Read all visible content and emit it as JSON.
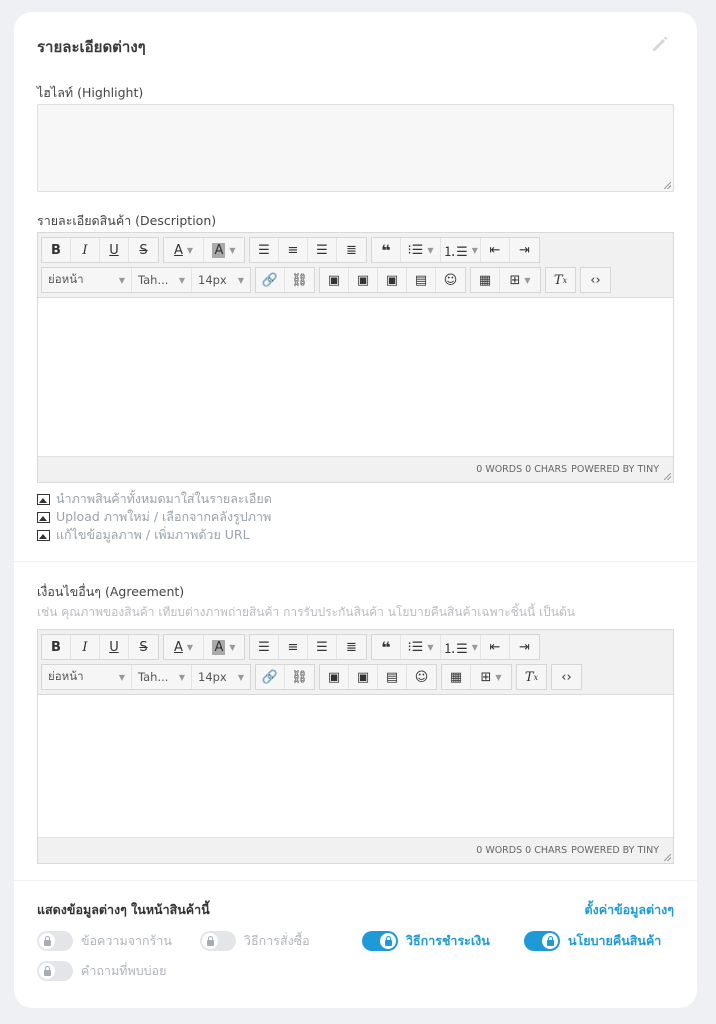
{
  "section_title": "รายละเอียดต่างๆ",
  "highlight": {
    "label": "ไฮไลท์ (Highlight)"
  },
  "description": {
    "label": "รายละเอียดสินค้า (Description)",
    "toolbar": {
      "block_format": "ย่อหน้า",
      "font_family": "Tah...",
      "font_size": "14px"
    },
    "status": {
      "words": "0 WORDS 0 CHARS",
      "powered": "POWERED BY TINY"
    }
  },
  "image_options": [
    "นำภาพสินค้าทั้งหมดมาใส่ในรายละเอียด",
    "Upload ภาพใหม่ / เลือกจากคลังรูปภาพ",
    "แก้ไขข้อมูลภาพ / เพิ่มภาพด้วย URL"
  ],
  "agreement": {
    "label": "เงื่อนไขอื่นๆ (Agreement)",
    "hint": "เช่น คุณภาพของสินค้า เทียบต่างภาพถ่ายสินค้า การรับประกันสินค้า นโยบายคืนสินค้าเฉพาะชิ้นนี้ เป็นต้น",
    "toolbar": {
      "block_format": "ย่อหน้า",
      "font_family": "Tah...",
      "font_size": "14px"
    },
    "status": {
      "words": "0 WORDS 0 CHARS",
      "powered": "POWERED BY TINY"
    }
  },
  "display": {
    "label": "แสดงข้อมูลต่างๆ ในหน้าสินค้านี้",
    "settings_link": "ตั้งค่าข้อมูลต่างๆ",
    "toggles": [
      {
        "label": "ข้อความจากร้าน",
        "on": false
      },
      {
        "label": "วิธีการสั่งซื้อ",
        "on": false
      },
      {
        "label": "วิธีการชำระเงิน",
        "on": true
      },
      {
        "label": "นโยบายคืนสินค้า",
        "on": true
      },
      {
        "label": "คำถามที่พบบ่อย",
        "on": false
      }
    ]
  },
  "colors": {
    "accent": "#1e9bd7",
    "muted": "#b0b5bb"
  }
}
